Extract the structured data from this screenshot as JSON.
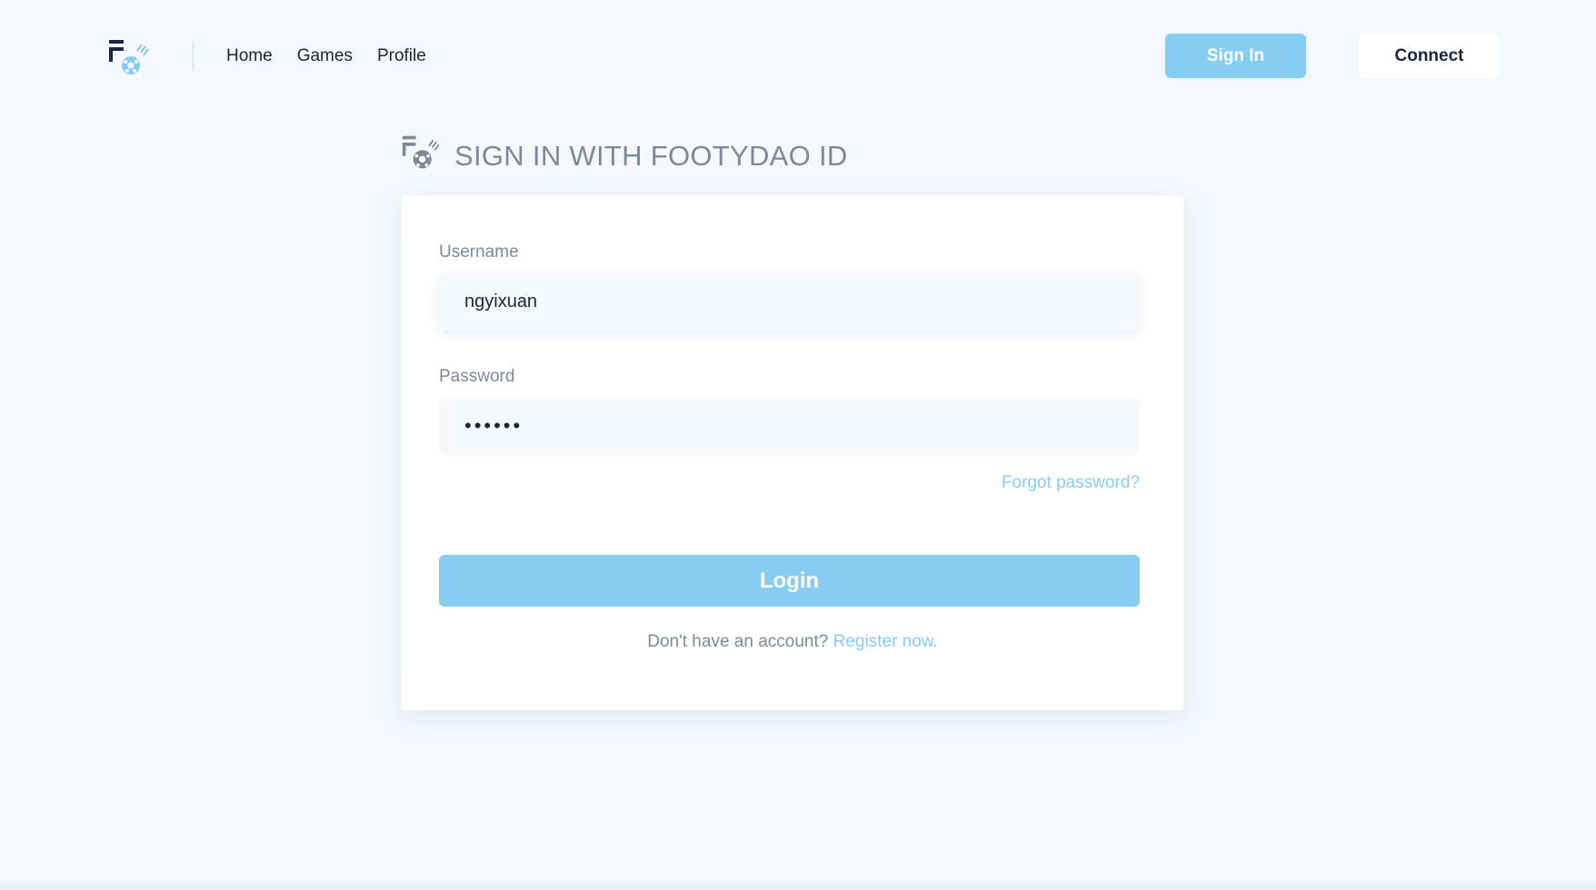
{
  "header": {
    "nav": [
      {
        "label": "Home"
      },
      {
        "label": "Games"
      },
      {
        "label": "Profile"
      }
    ],
    "signin_label": "Sign In",
    "connect_label": "Connect"
  },
  "login": {
    "title": "SIGN IN WITH FOOTYDAO ID",
    "username_label": "Username",
    "username_value": "ngyixuan",
    "password_label": "Password",
    "password_value": "••••••",
    "forgot_label": "Forgot password?",
    "login_label": "Login",
    "register_prompt": "Don't have an account?",
    "register_link": "Register now."
  },
  "colors": {
    "accent": "#87cdf2",
    "navy": "#1b2440",
    "muted": "#7e889c",
    "background": "#f5f8fc"
  },
  "icons": {
    "brand": "footydao-logo-icon"
  }
}
